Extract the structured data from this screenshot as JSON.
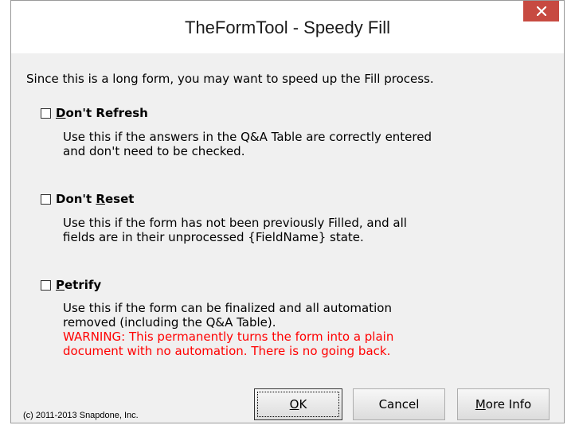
{
  "window": {
    "title": "TheFormTool - Speedy Fill",
    "close_icon": "close-icon"
  },
  "intro": "Since this is a long form, you may want to speed up the Fill process.",
  "options": [
    {
      "label_pre": "",
      "label_key": "D",
      "label_post": "on't Refresh",
      "checked": false,
      "desc": [
        "Use this if the answers in the Q&A Table are correctly entered",
        "and don't need to be checked."
      ]
    },
    {
      "label_pre": "Don't ",
      "label_key": "R",
      "label_post": "eset",
      "checked": false,
      "desc": [
        "Use this if the form has not been previously Filled, and all",
        "fields are in their unprocessed {FieldName} state."
      ]
    },
    {
      "label_pre": "",
      "label_key": "P",
      "label_post": "etrify",
      "checked": false,
      "desc": [
        "Use this if the form can be finalized and all automation",
        "removed (including the Q&A Table)."
      ],
      "warning": [
        "WARNING:  This permanently turns the form into a plain",
        "document with no automation.  There is no going back."
      ]
    }
  ],
  "copyright": "(c) 2011-2013 Snapdone, Inc.",
  "buttons": {
    "ok_key": "O",
    "ok_rest": "K",
    "cancel": "Cancel",
    "more_key": "M",
    "more_rest": "ore Info"
  },
  "colors": {
    "close_button": "#c74a41",
    "warning": "#ff0000",
    "dialog_bg": "#f0f0f0"
  }
}
